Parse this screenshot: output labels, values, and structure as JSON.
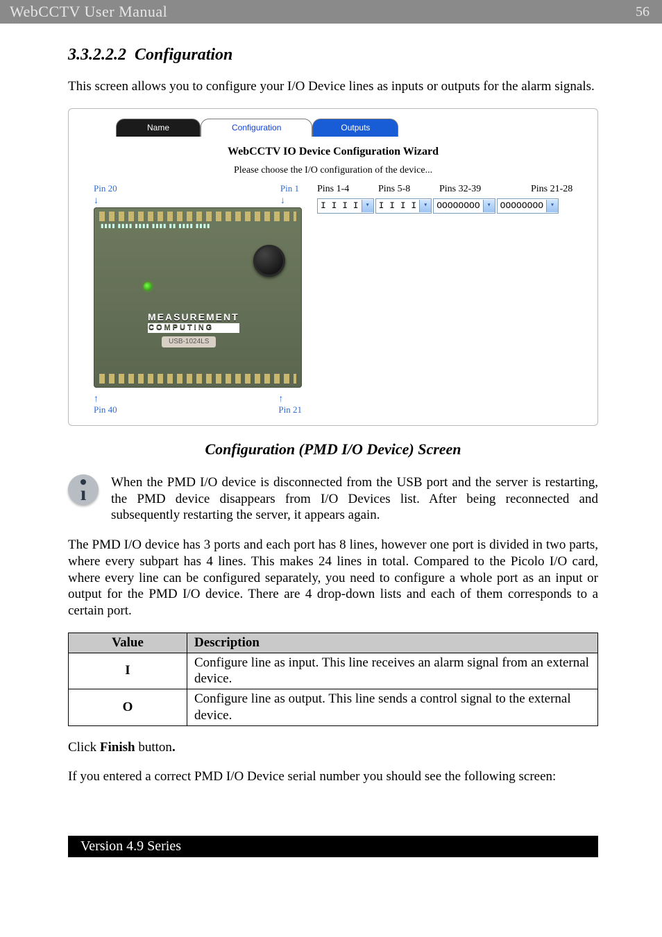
{
  "header": {
    "title": "WebCCTV User Manual",
    "page_number": "56"
  },
  "section": {
    "number": "3.3.2.2.2",
    "title": "Configuration",
    "intro": "This screen allows you to configure your I/O Device lines as inputs or outputs for the alarm signals."
  },
  "wizard": {
    "tabs": {
      "name": "Name",
      "configuration": "Configuration",
      "outputs": "Outputs"
    },
    "title": "WebCCTV IO Device Configuration Wizard",
    "subtitle": "Please choose the I/O configuration of the device...",
    "device": {
      "pin20": "Pin 20",
      "pin1": "Pin 1",
      "pin40": "Pin 40",
      "pin21": "Pin 21",
      "brand_top": "MEASUREMENT",
      "brand_bot": "COMPUTING",
      "model": "USB-1024LS"
    },
    "form": {
      "labels": {
        "p14": "Pins 1-4",
        "p58": "Pins 5-8",
        "p3239": "Pins 32-39",
        "p2128": "Pins 21-28"
      },
      "values": {
        "p14": "I I I I",
        "p58": "I I I I",
        "p3239": "OOOOOOOO",
        "p2128": "OOOOOOOO"
      }
    }
  },
  "caption": "Configuration (PMD I/O Device) Screen",
  "note": "When the PMD I/O device is disconnected from the USB port and the server is restarting, the PMD device disappears from I/O Devices list. After being reconnected and subsequently restarting the server, it appears again.",
  "para2": "The PMD I/O device has 3 ports and each port has 8 lines, however one port is divided in two parts, where every subpart has 4 lines. This makes 24 lines in total. Compared to the Picolo I/O card, where every line can be configured separately, you need to configure a whole port as an input or output for the PMD I/O device. There are 4 drop-down lists and each of them corresponds to a certain port.",
  "table": {
    "headers": {
      "value": "Value",
      "description": "Description"
    },
    "rows": [
      {
        "value": "I",
        "description": "Configure line as input. This line receives an alarm signal from an external device."
      },
      {
        "value": "O",
        "description": "Configure line as output. This line sends a control signal to the external device."
      }
    ]
  },
  "click_line_a": "Click ",
  "click_line_b": "Finish",
  "click_line_c": " button",
  "click_line_d": ".",
  "para3": "If you entered a correct PMD I/O Device serial number you should see the following screen:",
  "footer": "Version 4.9 Series"
}
